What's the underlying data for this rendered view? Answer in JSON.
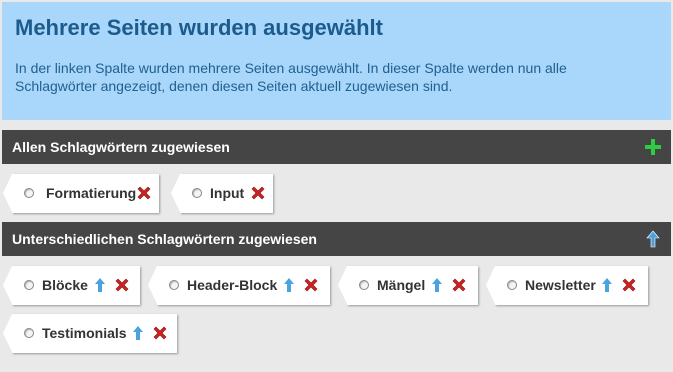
{
  "info": {
    "title": "Mehrere Seiten wurden ausgewählt",
    "line1": "In der linken Spalte wurden mehrere Seiten ausgewählt. In dieser Spalte werden nun alle",
    "line2": "Schlagwörter angezeigt, denen diesen Seiten aktuell zugewiesen sind."
  },
  "all_section": {
    "title": "Allen Schlagwörtern zugewiesen",
    "tags": [
      {
        "label": "Formatierung"
      },
      {
        "label": "Input"
      }
    ]
  },
  "diff_section": {
    "title": "Unterschiedlichen Schlagwörtern zugewiesen",
    "tags": [
      {
        "label": "Blöcke"
      },
      {
        "label": "Header-Block"
      },
      {
        "label": "Mängel"
      },
      {
        "label": "Newsletter"
      },
      {
        "label": "Testimonials"
      }
    ]
  },
  "colors": {
    "info_bg": "#a8d7fb",
    "header_bg": "#454545",
    "add_icon": "#2ecc40",
    "remove_icon": "#cc2222",
    "arrow_icon": "#4aa3df"
  },
  "icons": {
    "add": "plus-icon",
    "remove": "remove-x-icon",
    "move_up": "arrow-up-icon"
  }
}
